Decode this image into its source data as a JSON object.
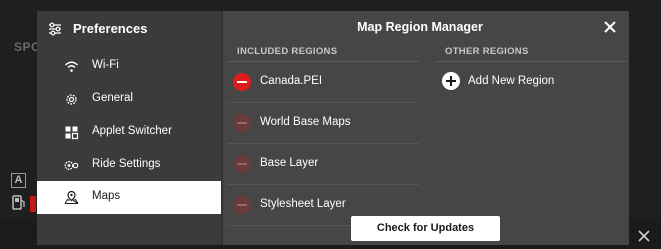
{
  "background": {
    "label": "SPO",
    "badge": "A"
  },
  "sidebar": {
    "title": "Preferences",
    "items": [
      {
        "label": "Wi-Fi",
        "icon": "wifi-icon"
      },
      {
        "label": "General",
        "icon": "gear-icon"
      },
      {
        "label": "Applet Switcher",
        "icon": "grid-icon"
      },
      {
        "label": "Ride Settings",
        "icon": "ride-settings-icon"
      },
      {
        "label": "Maps",
        "icon": "map-pin-icon",
        "active": true
      }
    ]
  },
  "main": {
    "title": "Map Region Manager",
    "included_header": "INCLUDED REGIONS",
    "other_header": "OTHER REGIONS",
    "included_regions": [
      {
        "label": "Canada.PEI",
        "enabled": true
      },
      {
        "label": "World Base Maps",
        "enabled": false
      },
      {
        "label": "Base Layer",
        "enabled": false
      },
      {
        "label": "Stylesheet Layer",
        "enabled": false
      }
    ],
    "add_region_label": "Add New Region",
    "update_button_label": "Check for Updates"
  },
  "colors": {
    "accent_red": "#e01b1b",
    "modal_bg": "#464646",
    "sidebar_bg": "#3b3b3b",
    "active_item_bg": "#ffffff"
  }
}
